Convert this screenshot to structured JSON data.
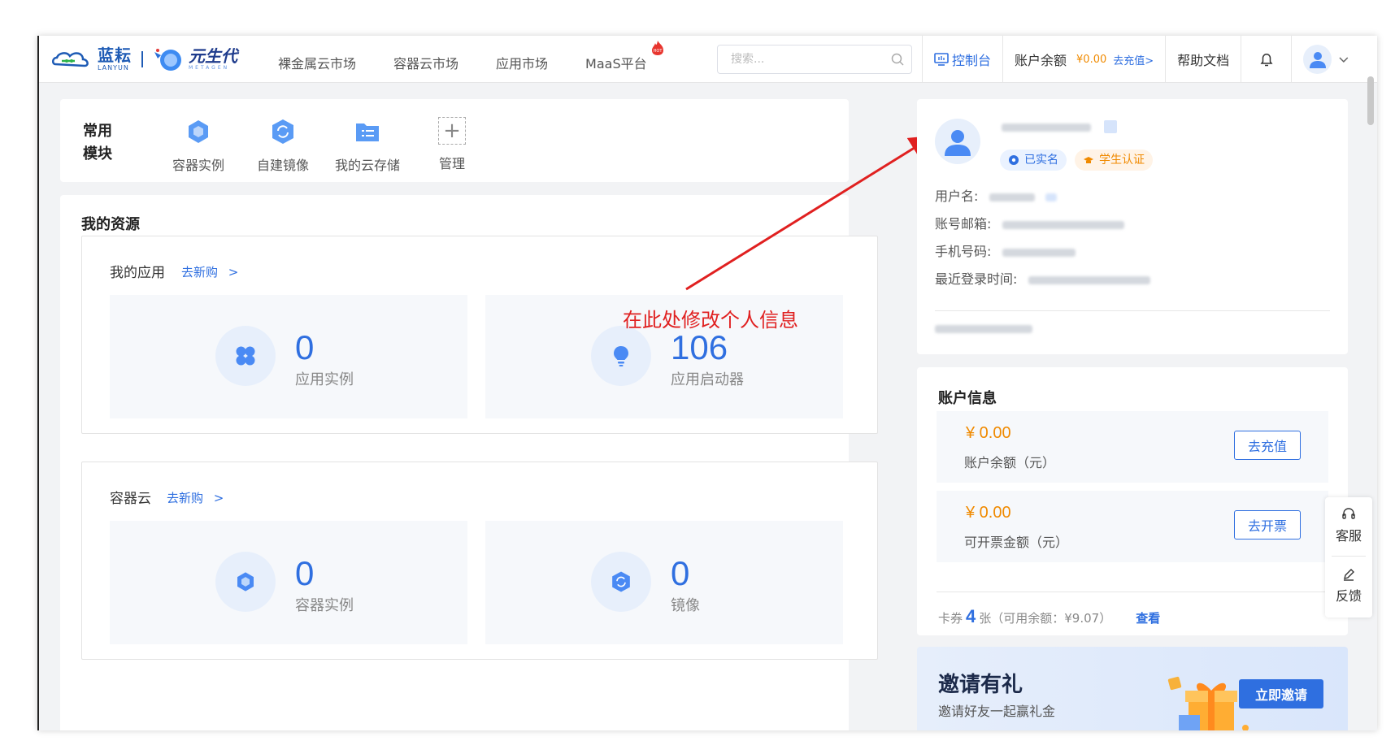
{
  "brand": {
    "lanyun_cn": "蓝耘",
    "lanyun_en": "LANYUN",
    "meta_cn": "元生代",
    "meta_en": "METAGEN"
  },
  "nav": {
    "items": [
      {
        "label": "裸金属云市场"
      },
      {
        "label": "容器云市场"
      },
      {
        "label": "应用市场"
      },
      {
        "label": "MaaS平台",
        "badge": "HOT"
      }
    ]
  },
  "search": {
    "placeholder": "搜索..."
  },
  "header": {
    "console": "控制台",
    "balance_label": "账户余额",
    "balance_amount": "¥0.00",
    "recharge_link": "去充值>",
    "help": "帮助文档"
  },
  "quick": {
    "title": "常用模块",
    "items": [
      {
        "label": "容器实例",
        "icon": "cube-icon"
      },
      {
        "label": "自建镜像",
        "icon": "mirror-icon"
      },
      {
        "label": "我的云存储",
        "icon": "folder-list-icon"
      },
      {
        "label": "管理",
        "icon": "plus-icon"
      }
    ]
  },
  "resources": {
    "title": "我的资源",
    "apps": {
      "title": "我的应用",
      "link": "去新购",
      "link_arrow": ">",
      "stats": [
        {
          "value": "0",
          "label": "应用实例"
        },
        {
          "value": "106",
          "label": "应用启动器"
        }
      ]
    },
    "container": {
      "title": "容器云",
      "link": "去新购",
      "link_arrow": ">",
      "stats": [
        {
          "value": "0",
          "label": "容器实例"
        },
        {
          "value": "0",
          "label": "镜像"
        }
      ]
    }
  },
  "annotation": "在此处修改个人信息",
  "profile": {
    "badge_real": "已实名",
    "badge_student": "学生认证",
    "fields": [
      {
        "label": "用户名:"
      },
      {
        "label": "账号邮箱:"
      },
      {
        "label": "手机号码:"
      },
      {
        "label": "最近登录时间:"
      }
    ]
  },
  "account": {
    "title": "账户信息",
    "balance": {
      "amount": "¥ 0.00",
      "label": "账户余额（元）",
      "button": "去充值"
    },
    "invoice": {
      "amount": "¥ 0.00",
      "label": "可开票金额（元）",
      "button": "去开票"
    },
    "coupon": {
      "prefix": "卡券",
      "count": "4",
      "suffix": "张（可用余额：¥9.07）",
      "link": "查看"
    }
  },
  "invite": {
    "title": "邀请有礼",
    "subtitle": "邀请好友一起赢礼金",
    "button": "立即邀请"
  },
  "tools": {
    "service": "客服",
    "feedback": "反馈"
  },
  "colors": {
    "primary": "#2f6fe0",
    "accent_orange": "#f08a00",
    "annotation_red": "#e02020"
  }
}
